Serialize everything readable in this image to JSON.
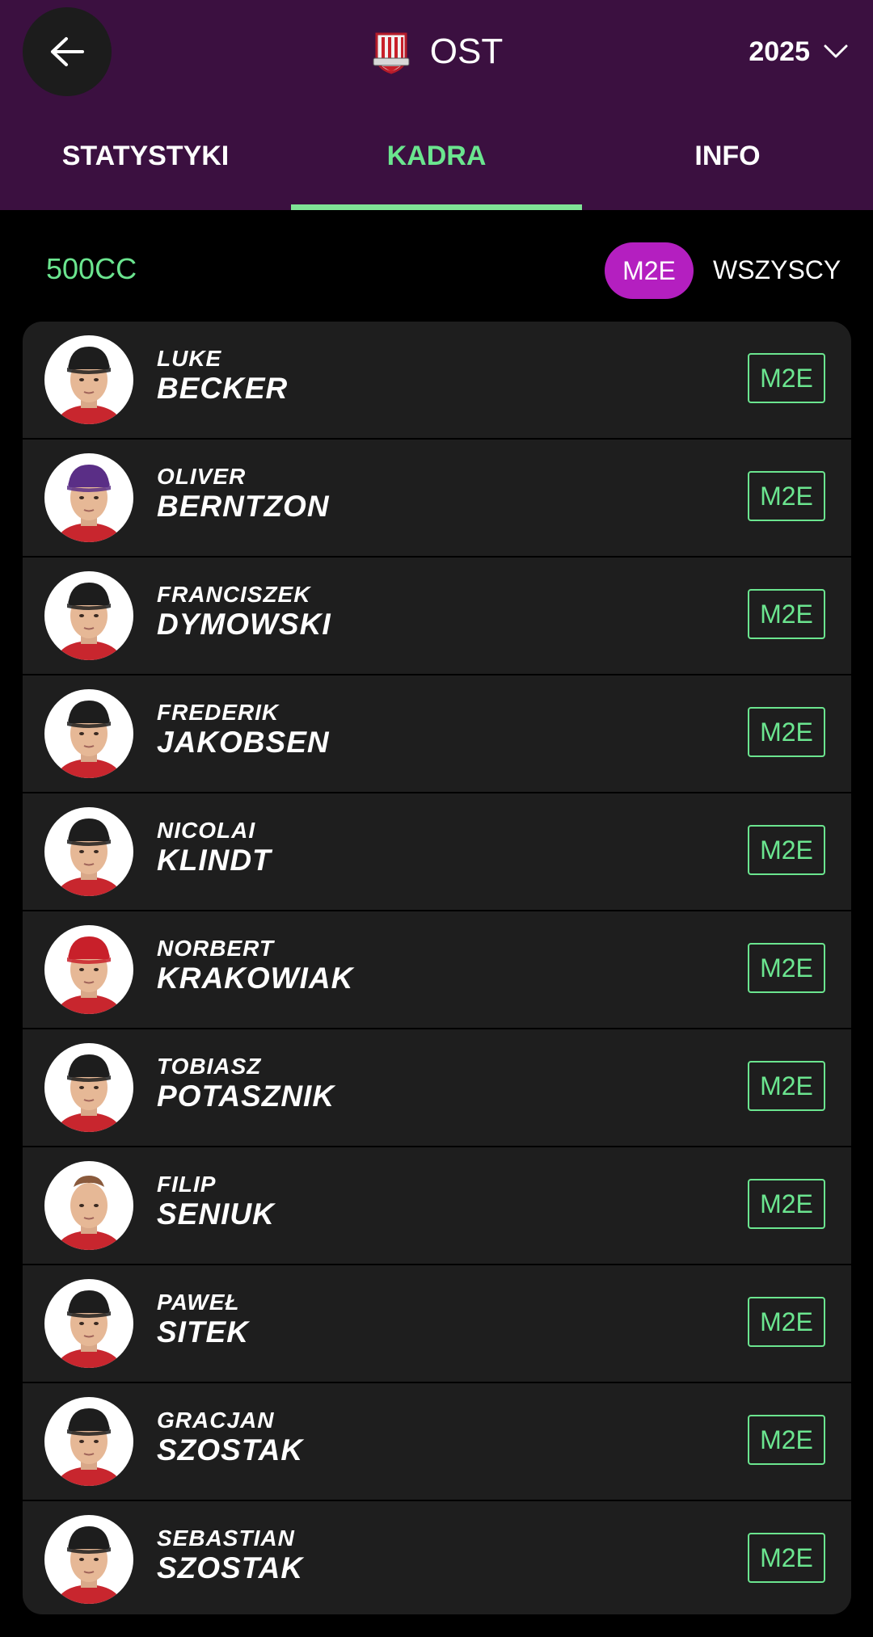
{
  "header": {
    "team_code": "OST",
    "season": "2025",
    "back_icon": "arrow-left-icon",
    "crest_icon": "team-crest-icon",
    "season_icon": "chevron-down-icon",
    "background_color": "#3b1040"
  },
  "tabs": [
    {
      "label": "STATYSTYKI",
      "active": false
    },
    {
      "label": "KADRA",
      "active": true
    },
    {
      "label": "INFO",
      "active": false
    }
  ],
  "filters": {
    "class_label": "500CC",
    "chip_selected": "M2E",
    "chip_all": "WSZYSCY"
  },
  "colors": {
    "accent_green": "#6be58f",
    "accent_magenta": "#b41fc0",
    "list_background": "#1e1e1e"
  },
  "riders": [
    {
      "first": "LUKE",
      "last": "BECKER",
      "badge": "M2E",
      "cap": "#1d1d1d"
    },
    {
      "first": "OLIVER",
      "last": "BERNTZON",
      "badge": "M2E",
      "cap": "#5a2e86"
    },
    {
      "first": "FRANCISZEK",
      "last": "DYMOWSKI",
      "badge": "M2E",
      "cap": "#1d1d1d"
    },
    {
      "first": "FREDERIK",
      "last": "JAKOBSEN",
      "badge": "M2E",
      "cap": "#1d1d1d"
    },
    {
      "first": "NICOLAI",
      "last": "KLINDT",
      "badge": "M2E",
      "cap": "#1d1d1d"
    },
    {
      "first": "NORBERT",
      "last": "KRAKOWIAK",
      "badge": "M2E",
      "cap": "#c8202a"
    },
    {
      "first": "TOBIASZ",
      "last": "POTASZNIK",
      "badge": "M2E",
      "cap": "#1d1d1d"
    },
    {
      "first": "FILIP",
      "last": "SENIUK",
      "badge": "M2E",
      "cap": ""
    },
    {
      "first": "PAWEŁ",
      "last": "SITEK",
      "badge": "M2E",
      "cap": "#1d1d1d"
    },
    {
      "first": "GRACJAN",
      "last": "SZOSTAK",
      "badge": "M2E",
      "cap": "#1d1d1d"
    },
    {
      "first": "SEBASTIAN",
      "last": "SZOSTAK",
      "badge": "M2E",
      "cap": "#1d1d1d"
    }
  ]
}
